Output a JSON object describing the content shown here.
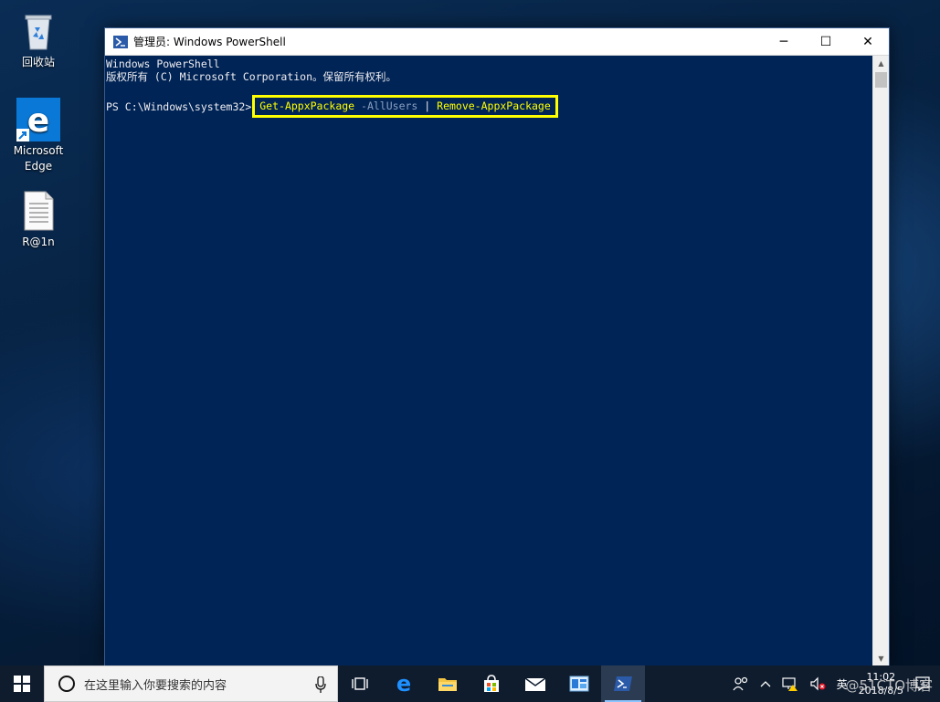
{
  "desktop": {
    "icons": [
      {
        "label": "回收站"
      },
      {
        "label": "Microsoft Edge"
      },
      {
        "label": "R@1n"
      }
    ]
  },
  "window": {
    "title": "管理员: Windows PowerShell",
    "controls": {
      "minimize": "─",
      "maximize": "☐",
      "close": "✕"
    }
  },
  "console": {
    "line1": "Windows PowerShell",
    "line2": "版权所有 (C) Microsoft Corporation。保留所有权利。",
    "prompt": "PS C:\\Windows\\system32>",
    "cmd_part1": "Get-AppxPackage",
    "cmd_param": " -AllUsers ",
    "cmd_pipe": "| ",
    "cmd_part2": "Remove-AppxPackage",
    "colors": {
      "background": "#012456",
      "highlight": "#ffff00"
    }
  },
  "taskbar": {
    "search_placeholder": "在这里输入你要搜索的内容",
    "ime": "英",
    "time": "11:02",
    "date": "2018/8/5",
    "notifications": "1"
  },
  "watermark": "@51CTO博客"
}
